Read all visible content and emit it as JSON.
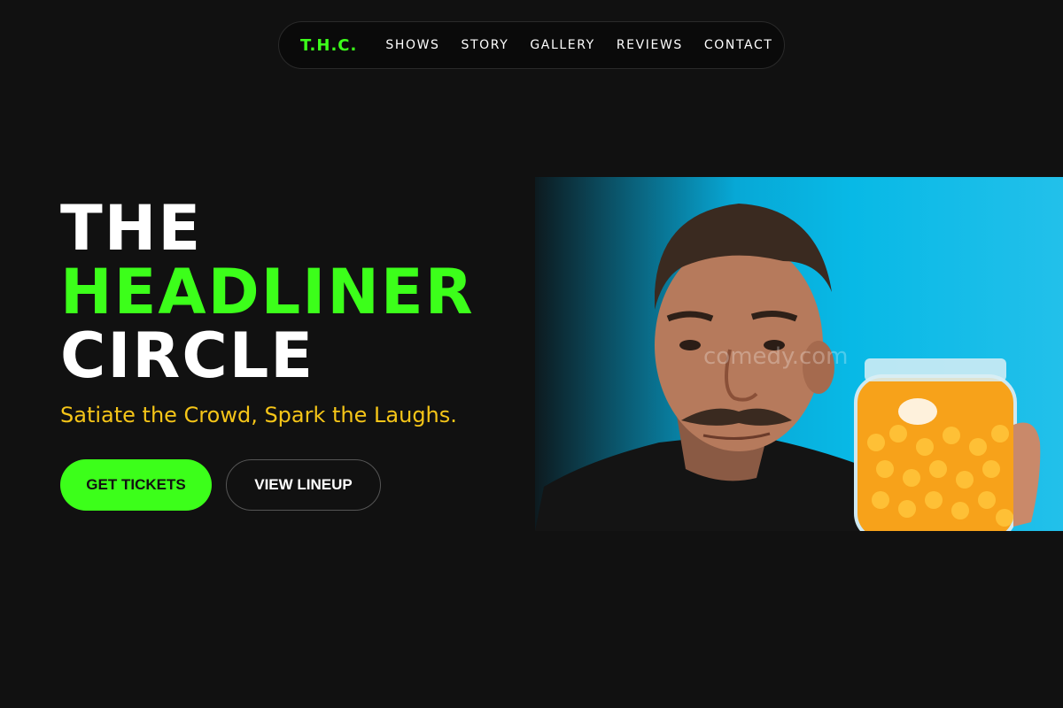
{
  "nav": {
    "logo": "T.H.C.",
    "links": [
      "SHOWS",
      "STORY",
      "GALLERY",
      "REVIEWS",
      "CONTACT"
    ]
  },
  "hero": {
    "title_line1": "THE",
    "title_line2": "HEADLINER",
    "title_line3": "CIRCLE",
    "tagline": "Satiate the Crowd, Spark the Laughs.",
    "primary_button": "GET TICKETS",
    "secondary_button": "VIEW LINEUP",
    "image_watermark": "comedy.com"
  },
  "colors": {
    "background": "#111111",
    "accent_green": "#3cff1a",
    "tagline_yellow": "#f5c518",
    "image_blue": "#08b9e6"
  }
}
